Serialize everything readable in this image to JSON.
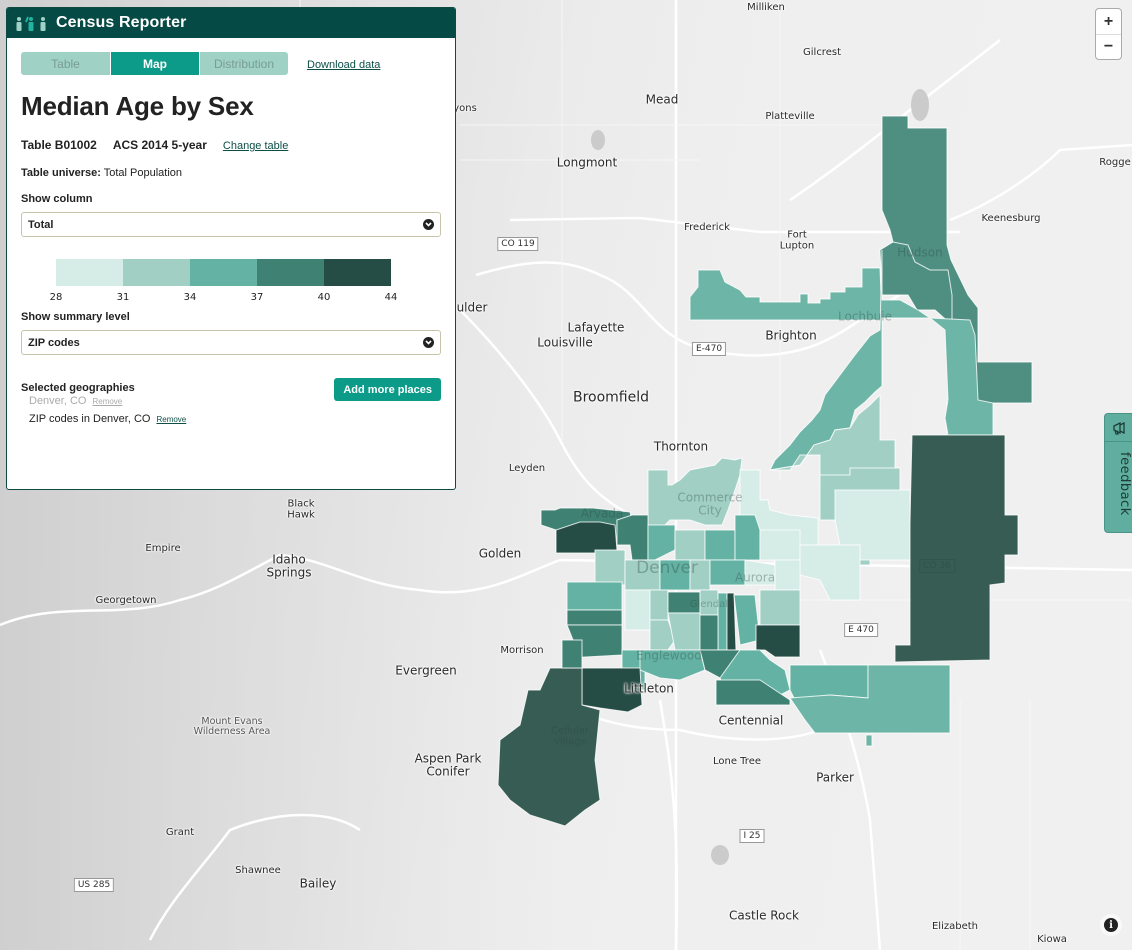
{
  "app": {
    "brand": "Census Reporter"
  },
  "tabs": [
    {
      "label": "Table",
      "active": false
    },
    {
      "label": "Map",
      "active": true
    },
    {
      "label": "Distribution",
      "active": false
    }
  ],
  "download_link": "Download data",
  "title": "Median Age by Sex",
  "table_id": "Table B01002",
  "dataset": "ACS 2014 5-year",
  "change_table": "Change table",
  "universe": {
    "label": "Table universe:",
    "value": "Total Population"
  },
  "show_column": {
    "label": "Show column",
    "selected": "Total"
  },
  "legend": {
    "colors": [
      "#d6ece7",
      "#a1cfc4",
      "#64b2a4",
      "#3f8274",
      "#264d45"
    ],
    "breaks": [
      "28",
      "31",
      "34",
      "37",
      "40",
      "44"
    ]
  },
  "summary_level": {
    "label": "Show summary level",
    "selected": "ZIP codes"
  },
  "geographies": {
    "label": "Selected geographies",
    "add_button": "Add more places",
    "items": [
      {
        "name": "Denver, CO",
        "remove": "Remove",
        "inactive": true
      },
      {
        "name": "ZIP codes in Denver, CO",
        "remove": "Remove",
        "inactive": false
      }
    ]
  },
  "map": {
    "zoom_in": "+",
    "zoom_out": "−",
    "feedback": "feedback",
    "info": "i",
    "places": [
      {
        "name": "Milliken",
        "size": "sm"
      },
      {
        "name": "Gilcrest",
        "size": "sm"
      },
      {
        "name": "Mead",
        "size": "md"
      },
      {
        "name": "Platteville",
        "size": "sm"
      },
      {
        "name": "Longmont",
        "size": "md"
      },
      {
        "name": "Rogge",
        "size": "sm"
      },
      {
        "name": "Keenesburg",
        "size": "sm"
      },
      {
        "name": "Frederick",
        "size": "sm"
      },
      {
        "name": "Fort\nLupton",
        "size": "sm"
      },
      {
        "name": "Hudson",
        "size": "md"
      },
      {
        "name": "ulder",
        "size": "md"
      },
      {
        "name": "Lafayette",
        "size": "md"
      },
      {
        "name": "Louisville",
        "size": "md"
      },
      {
        "name": "Brighton",
        "size": "md"
      },
      {
        "name": "Lochbuie",
        "size": "md"
      },
      {
        "name": "Broomfield",
        "size": "lg"
      },
      {
        "name": "Thornton",
        "size": "md"
      },
      {
        "name": "Leyden",
        "size": "sm"
      },
      {
        "name": "Commerce\nCity",
        "size": "md"
      },
      {
        "name": "Arvada",
        "size": "md"
      },
      {
        "name": "Black\nHawk",
        "size": "sm"
      },
      {
        "name": "Empire",
        "size": "sm"
      },
      {
        "name": "Idaho\nSprings",
        "size": "md"
      },
      {
        "name": "Golden",
        "size": "md"
      },
      {
        "name": "Denver",
        "size": "lg"
      },
      {
        "name": "Aurora",
        "size": "md"
      },
      {
        "name": "Georgetown",
        "size": "sm"
      },
      {
        "name": "Glendale",
        "size": "sm"
      },
      {
        "name": "Morrison",
        "size": "sm"
      },
      {
        "name": "Englewood",
        "size": "md"
      },
      {
        "name": "Evergreen",
        "size": "md"
      },
      {
        "name": "Littleton",
        "size": "md"
      },
      {
        "name": "Centennial",
        "size": "md"
      },
      {
        "name": "Mount Evans\nWilderness Area",
        "size": "gray"
      },
      {
        "name": "Cellular\nVillage",
        "size": "sm"
      },
      {
        "name": "Aspen Park\nConifer",
        "size": "md"
      },
      {
        "name": "Lone Tree",
        "size": "sm"
      },
      {
        "name": "Parker",
        "size": "md"
      },
      {
        "name": "Grant",
        "size": "sm"
      },
      {
        "name": "Shawnee",
        "size": "sm"
      },
      {
        "name": "Bailey",
        "size": "md"
      },
      {
        "name": "Castle Rock",
        "size": "md"
      },
      {
        "name": "Elizabeth",
        "size": "sm"
      },
      {
        "name": "Kiowa",
        "size": "sm"
      },
      {
        "name": "yons",
        "size": "sm"
      }
    ],
    "shields": [
      "CO 119",
      "E-470",
      "CO 36",
      "E 470",
      "I 25",
      "US 285"
    ]
  }
}
